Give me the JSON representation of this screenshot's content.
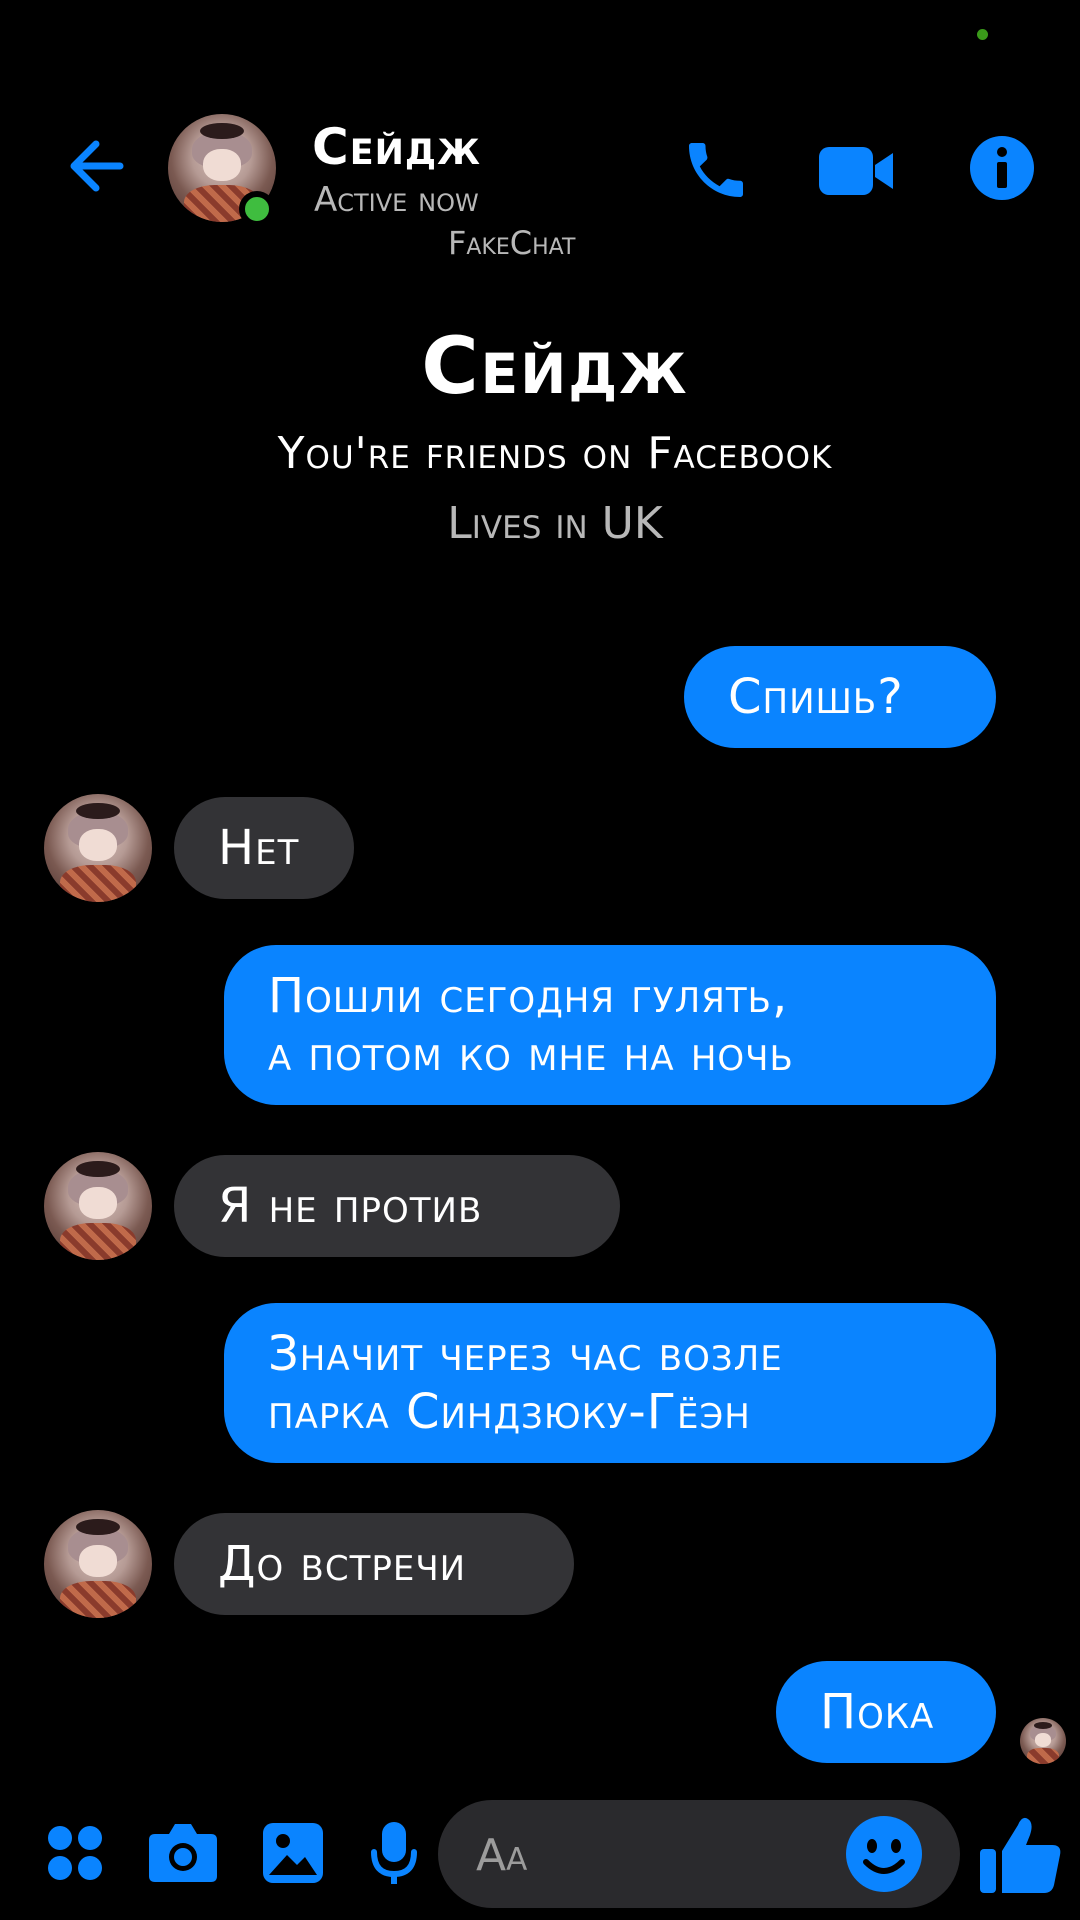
{
  "colors": {
    "accent": "#0a84ff",
    "incoming_bubble": "#333336",
    "online": "#3fbd3f",
    "background": "#000000"
  },
  "header": {
    "back_icon": "arrow-left-icon",
    "contact_name": "Сейдж",
    "status": "Active now",
    "watermark": "FakeChat",
    "icons": [
      "phone-icon",
      "video-camera-icon",
      "info-icon"
    ]
  },
  "intro": {
    "name": "Сейдж",
    "friends_line": "You're friends on Facebook",
    "location": "Lives in UK"
  },
  "messages": [
    {
      "direction": "outgoing",
      "text": "Спишь?"
    },
    {
      "direction": "incoming",
      "text": "Нет"
    },
    {
      "direction": "outgoing",
      "lines": [
        "Пошли сегодня гулять,",
        "а потом ко мне на ночь"
      ]
    },
    {
      "direction": "incoming",
      "text": "Я не против"
    },
    {
      "direction": "outgoing",
      "lines": [
        "Значит через час возле",
        "парка Синдзюку-Гёэн"
      ]
    },
    {
      "direction": "incoming",
      "text": "До встречи"
    },
    {
      "direction": "outgoing",
      "text": "Пока"
    }
  ],
  "composer": {
    "placeholder": "Aa",
    "icons": [
      "apps-grid-icon",
      "camera-icon",
      "image-icon",
      "microphone-icon",
      "emoji-icon",
      "thumbs-up-icon"
    ]
  }
}
